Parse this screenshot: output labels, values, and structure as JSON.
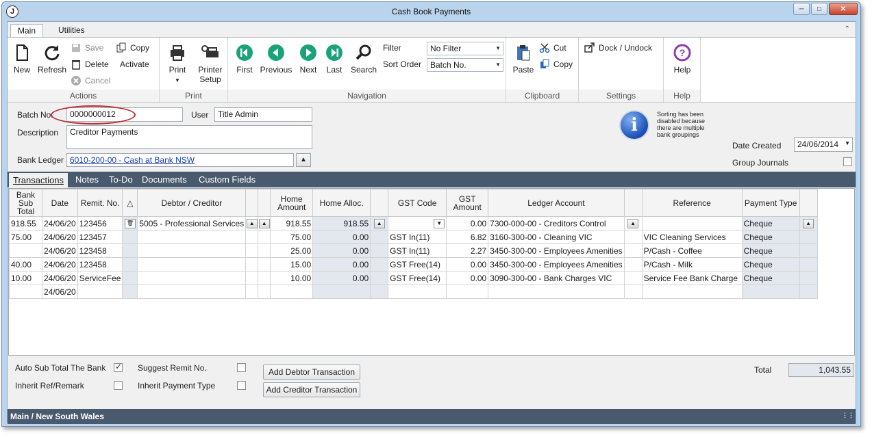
{
  "window": {
    "title": "Cash Book Payments",
    "app_icon_letter": "J"
  },
  "ribbon_tabs": [
    "Main",
    "Utilities"
  ],
  "ribbon": {
    "actions": {
      "new": "New",
      "refresh": "Refresh",
      "save": "Save",
      "delete": "Delete",
      "cancel": "Cancel",
      "copy": "Copy",
      "activate": "Activate",
      "group": "Actions"
    },
    "print": {
      "print": "Print",
      "printer_setup_1": "Printer",
      "printer_setup_2": "Setup",
      "group": "Print"
    },
    "navigation": {
      "first": "First",
      "previous": "Previous",
      "next": "Next",
      "last": "Last",
      "search": "Search",
      "filter_label": "Filter",
      "filter_value": "No Filter",
      "sort_label": "Sort Order",
      "sort_value": "Batch No.",
      "group": "Navigation"
    },
    "clipboard": {
      "paste": "Paste",
      "cut": "Cut",
      "copy": "Copy",
      "group": "Clipboard"
    },
    "settings": {
      "dock": "Dock / Undock",
      "group": "Settings"
    },
    "help": {
      "help": "Help",
      "group": "Help"
    }
  },
  "header": {
    "batch_no_label": "Batch No.",
    "batch_no": "0000000012",
    "user_label": "User",
    "user": "Title Admin",
    "description_label": "Description",
    "description": "Creditor Payments",
    "bank_ledger_label": "Bank Ledger",
    "bank_ledger": "6010-200-00 - Cash at Bank NSW",
    "info_message": "Sorting has been disabled because there are multiple bank groupings",
    "date_created_label": "Date Created",
    "date_created": "24/06/2014",
    "group_journals_label": "Group Journals"
  },
  "detail_tabs": [
    "Transactions",
    "Notes",
    "To-Do",
    "Documents",
    "Custom Fields"
  ],
  "grid": {
    "columns": [
      "Bank Sub Total",
      "Date",
      "Remit. No.",
      "Debtor / Creditor",
      "Home Amount",
      "Home Alloc.",
      "GST Code",
      "GST Amount",
      "Ledger Account",
      "Reference",
      "Payment Type"
    ],
    "rows": [
      {
        "subtotal": "918.55",
        "date": "24/06/20",
        "remit": "123456",
        "party": "5005 - Professional Services",
        "amount": "918.55",
        "alloc": "918.55",
        "gst_code": "",
        "gst_amount": "0.00",
        "ledger": "7300-000-00 - Creditors Control",
        "reference": "",
        "payment_type": "Cheque"
      },
      {
        "subtotal": "75.00",
        "date": "24/06/20",
        "remit": "123457",
        "party": "",
        "amount": "75.00",
        "alloc": "0.00",
        "gst_code": "GST In(11)",
        "gst_amount": "6.82",
        "ledger": "3160-300-00 - Cleaning VIC",
        "reference": "VIC Cleaning Services",
        "payment_type": "Cheque"
      },
      {
        "subtotal": "",
        "date": "24/06/20",
        "remit": "123458",
        "party": "",
        "amount": "25.00",
        "alloc": "0.00",
        "gst_code": "GST In(11)",
        "gst_amount": "2.27",
        "ledger": "3450-300-00 - Employees Amenities",
        "reference": "P/Cash - Coffee",
        "payment_type": "Cheque"
      },
      {
        "subtotal": "40.00",
        "date": "24/06/20",
        "remit": "123458",
        "party": "",
        "amount": "15.00",
        "alloc": "0.00",
        "gst_code": "GST Free(14)",
        "gst_amount": "0.00",
        "ledger": "3450-300-00 - Employees Amenities",
        "reference": "P/Cash - Milk",
        "payment_type": "Cheque"
      },
      {
        "subtotal": "10.00",
        "date": "24/06/20",
        "remit": "ServiceFee",
        "party": "",
        "amount": "10.00",
        "alloc": "0.00",
        "gst_code": "GST Free(14)",
        "gst_amount": "0.00",
        "ledger": "3090-300-00 - Bank Charges VIC",
        "reference": "Service Fee Bank Charge",
        "payment_type": "Cheque"
      },
      {
        "subtotal": "",
        "date": "24/06/20",
        "remit": "",
        "party": "",
        "amount": "",
        "alloc": "",
        "gst_code": "",
        "gst_amount": "",
        "ledger": "",
        "reference": "",
        "payment_type": ""
      }
    ]
  },
  "footer": {
    "auto_sub_total_label": "Auto Sub Total The Bank",
    "auto_sub_total_checked": true,
    "inherit_ref_label": "Inherit Ref/Remark",
    "suggest_remit_label": "Suggest Remit No.",
    "inherit_payment_label": "Inherit Payment Type",
    "add_debtor": "Add Debtor Transaction",
    "add_creditor": "Add Creditor Transaction",
    "total_label": "Total",
    "total": "1,043.55"
  },
  "status": {
    "text": "Main / New South Wales"
  },
  "colors": {
    "accent": "#4a5a6e",
    "nav_green": "#1aa37a",
    "highlight": "#c0272d"
  }
}
